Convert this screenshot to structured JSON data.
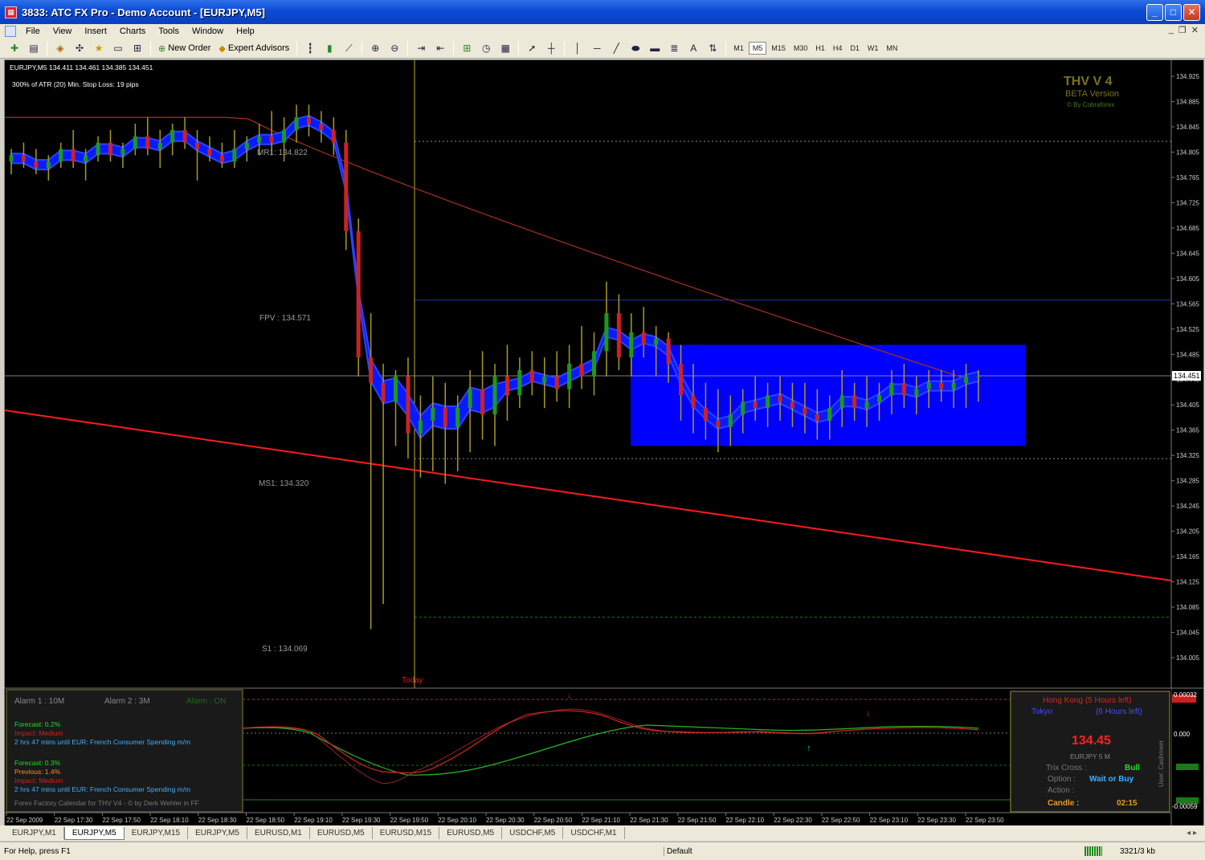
{
  "window": {
    "app_icon": "chart-app-icon",
    "title": "3833: ATC FX Pro - Demo Account - [EURJPY,M5]",
    "buttons": [
      "minimize",
      "maximize",
      "close"
    ]
  },
  "menu": {
    "items": [
      "File",
      "View",
      "Insert",
      "Charts",
      "Tools",
      "Window",
      "Help"
    ]
  },
  "toolbar": {
    "new_order_label": "New Order",
    "expert_advisors_label": "Expert Advisors",
    "timeframes": [
      "M1",
      "M5",
      "M15",
      "M30",
      "H1",
      "H4",
      "D1",
      "W1",
      "MN"
    ],
    "active_timeframe": "M5"
  },
  "chart_info": {
    "symbol_line": "EURJPY,M5  134.411 134.461 134.385 134.451",
    "atr_line": "300% of ATR (20)    Min. Stop Loss:  19 pips",
    "brand_title": "THV V 4",
    "brand_sub": "BETA Version",
    "brand_credit": "© By Cobraforex"
  },
  "levels": {
    "mr1": "MR1: 134.822",
    "fpv": "FPV : 134.571",
    "ms1": "MS1: 134.320",
    "s1": "S1 : 134.069",
    "today": "Today",
    "current_price": "134.451"
  },
  "chart_data": {
    "type": "candlestick",
    "symbol": "EURJPY",
    "timeframe": "M5",
    "ylim": [
      134.005,
      134.925
    ],
    "y_ticks": [
      "134.925",
      "134.885",
      "134.845",
      "134.805",
      "134.765",
      "134.725",
      "134.685",
      "134.645",
      "134.605",
      "134.565",
      "134.525",
      "134.485",
      "134.445",
      "134.405",
      "134.365",
      "134.325",
      "134.285",
      "134.245",
      "134.205",
      "134.165",
      "134.125",
      "134.085",
      "134.045",
      "134.005"
    ],
    "x_ticks": [
      "22 Sep 2009",
      "22 Sep 17:30",
      "22 Sep 17:50",
      "22 Sep 18:10",
      "22 Sep 18:30",
      "22 Sep 18:50",
      "22 Sep 19:10",
      "22 Sep 19:30",
      "22 Sep 19:50",
      "22 Sep 20:10",
      "22 Sep 20:30",
      "22 Sep 20:50",
      "22 Sep 21:10",
      "22 Sep 21:30",
      "22 Sep 21:50",
      "22 Sep 22:10",
      "22 Sep 22:30",
      "22 Sep 22:50",
      "22 Sep 23:10",
      "22 Sep 23:30",
      "22 Sep 23:50"
    ],
    "last_price": 134.451,
    "pivot_levels": {
      "MR1": 134.822,
      "FPV": 134.571,
      "MS1": 134.32,
      "S1": 134.069
    },
    "range_box": {
      "top": 134.5,
      "bottom": 134.34
    },
    "candles": [
      {
        "o": 134.79,
        "h": 134.81,
        "l": 134.77,
        "c": 134.8
      },
      {
        "o": 134.8,
        "h": 134.82,
        "l": 134.78,
        "c": 134.79
      },
      {
        "o": 134.79,
        "h": 134.81,
        "l": 134.77,
        "c": 134.78
      },
      {
        "o": 134.78,
        "h": 134.8,
        "l": 134.76,
        "c": 134.79
      },
      {
        "o": 134.79,
        "h": 134.82,
        "l": 134.78,
        "c": 134.81
      },
      {
        "o": 134.81,
        "h": 134.84,
        "l": 134.78,
        "c": 134.79
      },
      {
        "o": 134.79,
        "h": 134.81,
        "l": 134.76,
        "c": 134.8
      },
      {
        "o": 134.8,
        "h": 134.83,
        "l": 134.79,
        "c": 134.82
      },
      {
        "o": 134.82,
        "h": 134.84,
        "l": 134.79,
        "c": 134.8
      },
      {
        "o": 134.8,
        "h": 134.82,
        "l": 134.78,
        "c": 134.81
      },
      {
        "o": 134.81,
        "h": 134.85,
        "l": 134.8,
        "c": 134.83
      },
      {
        "o": 134.83,
        "h": 134.86,
        "l": 134.8,
        "c": 134.81
      },
      {
        "o": 134.81,
        "h": 134.84,
        "l": 134.78,
        "c": 134.82
      },
      {
        "o": 134.82,
        "h": 134.85,
        "l": 134.8,
        "c": 134.84
      },
      {
        "o": 134.84,
        "h": 134.86,
        "l": 134.81,
        "c": 134.82
      },
      {
        "o": 134.82,
        "h": 134.84,
        "l": 134.76,
        "c": 134.81
      },
      {
        "o": 134.81,
        "h": 134.83,
        "l": 134.79,
        "c": 134.8
      },
      {
        "o": 134.8,
        "h": 134.82,
        "l": 134.78,
        "c": 134.79
      },
      {
        "o": 134.79,
        "h": 134.84,
        "l": 134.78,
        "c": 134.81
      },
      {
        "o": 134.81,
        "h": 134.83,
        "l": 134.79,
        "c": 134.82
      },
      {
        "o": 134.82,
        "h": 134.85,
        "l": 134.8,
        "c": 134.83
      },
      {
        "o": 134.83,
        "h": 134.87,
        "l": 134.8,
        "c": 134.82
      },
      {
        "o": 134.82,
        "h": 134.86,
        "l": 134.79,
        "c": 134.84
      },
      {
        "o": 134.84,
        "h": 134.88,
        "l": 134.82,
        "c": 134.86
      },
      {
        "o": 134.86,
        "h": 134.88,
        "l": 134.83,
        "c": 134.85
      },
      {
        "o": 134.85,
        "h": 134.87,
        "l": 134.82,
        "c": 134.84
      },
      {
        "o": 134.84,
        "h": 134.86,
        "l": 134.8,
        "c": 134.82
      },
      {
        "o": 134.82,
        "h": 134.84,
        "l": 134.65,
        "c": 134.68
      },
      {
        "o": 134.68,
        "h": 134.7,
        "l": 134.45,
        "c": 134.48
      },
      {
        "o": 134.48,
        "h": 134.55,
        "l": 134.05,
        "c": 134.44
      },
      {
        "o": 134.44,
        "h": 134.47,
        "l": 134.09,
        "c": 134.41
      },
      {
        "o": 134.41,
        "h": 134.46,
        "l": 134.34,
        "c": 134.45
      },
      {
        "o": 134.45,
        "h": 134.48,
        "l": 134.32,
        "c": 134.36
      },
      {
        "o": 134.36,
        "h": 134.42,
        "l": 134.29,
        "c": 134.38
      },
      {
        "o": 134.38,
        "h": 134.45,
        "l": 134.3,
        "c": 134.4
      },
      {
        "o": 134.4,
        "h": 134.44,
        "l": 134.28,
        "c": 134.37
      },
      {
        "o": 134.37,
        "h": 134.42,
        "l": 134.3,
        "c": 134.4
      },
      {
        "o": 134.4,
        "h": 134.46,
        "l": 134.33,
        "c": 134.43
      },
      {
        "o": 134.43,
        "h": 134.49,
        "l": 134.35,
        "c": 134.39
      },
      {
        "o": 134.39,
        "h": 134.47,
        "l": 134.34,
        "c": 134.45
      },
      {
        "o": 134.45,
        "h": 134.5,
        "l": 134.38,
        "c": 134.42
      },
      {
        "o": 134.42,
        "h": 134.48,
        "l": 134.4,
        "c": 134.46
      },
      {
        "o": 134.46,
        "h": 134.49,
        "l": 134.42,
        "c": 134.44
      },
      {
        "o": 134.44,
        "h": 134.48,
        "l": 134.4,
        "c": 134.45
      },
      {
        "o": 134.45,
        "h": 134.49,
        "l": 134.41,
        "c": 134.43
      },
      {
        "o": 134.43,
        "h": 134.5,
        "l": 134.4,
        "c": 134.47
      },
      {
        "o": 134.47,
        "h": 134.53,
        "l": 134.43,
        "c": 134.45
      },
      {
        "o": 134.45,
        "h": 134.52,
        "l": 134.42,
        "c": 134.49
      },
      {
        "o": 134.49,
        "h": 134.6,
        "l": 134.45,
        "c": 134.55
      },
      {
        "o": 134.55,
        "h": 134.58,
        "l": 134.46,
        "c": 134.48
      },
      {
        "o": 134.48,
        "h": 134.55,
        "l": 134.45,
        "c": 134.52
      },
      {
        "o": 134.52,
        "h": 134.56,
        "l": 134.48,
        "c": 134.5
      },
      {
        "o": 134.5,
        "h": 134.53,
        "l": 134.45,
        "c": 134.51
      },
      {
        "o": 134.51,
        "h": 134.52,
        "l": 134.44,
        "c": 134.47
      },
      {
        "o": 134.47,
        "h": 134.5,
        "l": 134.38,
        "c": 134.42
      },
      {
        "o": 134.42,
        "h": 134.47,
        "l": 134.36,
        "c": 134.4
      },
      {
        "o": 134.4,
        "h": 134.44,
        "l": 134.35,
        "c": 134.38
      },
      {
        "o": 134.38,
        "h": 134.43,
        "l": 134.33,
        "c": 134.37
      },
      {
        "o": 134.37,
        "h": 134.42,
        "l": 134.34,
        "c": 134.39
      },
      {
        "o": 134.39,
        "h": 134.43,
        "l": 134.36,
        "c": 134.41
      },
      {
        "o": 134.41,
        "h": 134.45,
        "l": 134.38,
        "c": 134.4
      },
      {
        "o": 134.4,
        "h": 134.44,
        "l": 134.37,
        "c": 134.42
      },
      {
        "o": 134.42,
        "h": 134.45,
        "l": 134.38,
        "c": 134.41
      },
      {
        "o": 134.41,
        "h": 134.44,
        "l": 134.37,
        "c": 134.4
      },
      {
        "o": 134.4,
        "h": 134.44,
        "l": 134.36,
        "c": 134.39
      },
      {
        "o": 134.39,
        "h": 134.43,
        "l": 134.35,
        "c": 134.38
      },
      {
        "o": 134.38,
        "h": 134.42,
        "l": 134.35,
        "c": 134.4
      },
      {
        "o": 134.4,
        "h": 134.46,
        "l": 134.37,
        "c": 134.42
      },
      {
        "o": 134.42,
        "h": 134.44,
        "l": 134.38,
        "c": 134.4
      },
      {
        "o": 134.4,
        "h": 134.45,
        "l": 134.37,
        "c": 134.41
      },
      {
        "o": 134.41,
        "h": 134.44,
        "l": 134.38,
        "c": 134.42
      },
      {
        "o": 134.42,
        "h": 134.46,
        "l": 134.39,
        "c": 134.44
      },
      {
        "o": 134.44,
        "h": 134.47,
        "l": 134.4,
        "c": 134.42
      },
      {
        "o": 134.42,
        "h": 134.45,
        "l": 134.39,
        "c": 134.43
      },
      {
        "o": 134.43,
        "h": 134.46,
        "l": 134.4,
        "c": 134.44
      },
      {
        "o": 134.44,
        "h": 134.46,
        "l": 134.41,
        "c": 134.43
      },
      {
        "o": 134.43,
        "h": 134.46,
        "l": 134.4,
        "c": 134.44
      },
      {
        "o": 134.44,
        "h": 134.47,
        "l": 134.4,
        "c": 134.45
      },
      {
        "o": 134.45,
        "h": 134.46,
        "l": 134.41,
        "c": 134.45
      }
    ]
  },
  "news_panel": {
    "alarm1": "Alarm 1 : 10M",
    "alarm2": "Alarm 2 : 3M",
    "alarm_state": "Alarm : ON",
    "n1_forecast": "Forecast: 0.2%",
    "n1_impact": "Impact: Medium",
    "n1_event": "2 hrs 47 mins until EUR: French Consumer Spending m/m",
    "n2_forecast": "Forecast: 0.3%",
    "n2_previous": "Previous: 1.4%",
    "n2_impact": "Impact: Medium",
    "n2_event": "2 hrs 47 mins until EUR: French Consumer Spending m/m",
    "credit": "Forex Factory Calendar for THV V4 - © by Derk Wehler in FF"
  },
  "info_panel": {
    "session1": "Hong Kong  (5 Hours left)",
    "session2_name": "Tokyo",
    "session2_time": "(6 Hours left)",
    "price": "134.45",
    "symbol_tf": "EURJPY  5 M",
    "trix_label": "Trix Cross  :",
    "trix_value": "Bull",
    "option_label": "Option  :",
    "option_value": "Wait or Buy",
    "action_label": "Action  :",
    "candle_label": "Candle      :",
    "candle_value": "02:15",
    "user": "User: Cashmeer"
  },
  "sub_axis": {
    "top": "0.00032",
    "mid": "0.000",
    "bottom": "-0.00059"
  },
  "tabs": [
    "EURJPY,M1",
    "EURJPY,M5",
    "EURJPY,M15",
    "EURJPY,M5",
    "EURUSD,M1",
    "EURUSD,M5",
    "EURUSD,M15",
    "EURUSD,M5",
    "USDCHF,M5",
    "USDCHF,M1"
  ],
  "status": {
    "help": "For Help, press F1",
    "profile": "Default",
    "traffic": "3321/3 kb"
  },
  "colors": {
    "bull": "#1a9a1a",
    "bear": "#cc2222",
    "wick": "#a89a20",
    "cloud": "#0000ff",
    "trend": "#ff1a1a"
  }
}
